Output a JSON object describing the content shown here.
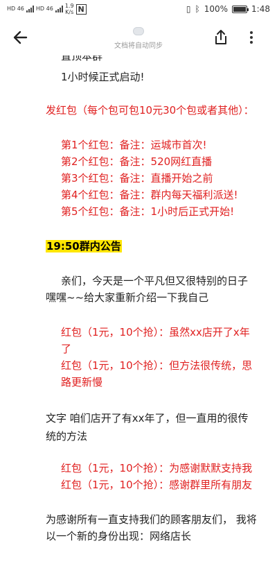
{
  "status_bar": {
    "sim1": "HD 46",
    "sim2": "HD 46",
    "net_speed": "1.9",
    "net_speed_unit": "K/s",
    "nfc": "N",
    "battery": "100%",
    "time": "1:48"
  },
  "app_bar": {
    "sync_status": "文档将自动同步"
  },
  "doc": {
    "intro_line_1": "置顶本群",
    "intro_line_2": "1小时候正式启动!",
    "red_packet_header": "发红包（每个包可包10元30个包或者其他）：",
    "red_packets": [
      "第1个红包：备注：运城市首次!",
      "第2个红包：备注：520网红直播",
      "第3个红包：备注：直播开始之前",
      "第4个红包：备注：群内每天福利派送!",
      "第5个红包：备注：1小时后正式开始!"
    ],
    "announcement_title": "19:50群内公告",
    "greeting_1": "亲们，今天是一个平凡但又很特别的日子",
    "greeting_2": "嘿嘿~~给大家重新介绍一下我自己",
    "rp_a_1": "红包（1元，10个抢）：虽然xx店开了x年",
    "rp_a_2": "了",
    "rp_b_1": "红包（1元，10个抢）：但方法很传统，思",
    "rp_b_2": "路更新慢",
    "text_1": " 文字  咱们店开了有xx年了，但一直用的很传",
    "text_2": "统的方法",
    "rp_c": "红包（1元，10个抢）：为感谢默默支持我",
    "rp_d": "红包（1元，10个抢）：感谢群里所有朋友",
    "thanks_1": "为感谢所有一直支持我们的顾客朋友们，  我将",
    "thanks_2": "以一个新的身份出现：网络店长"
  }
}
